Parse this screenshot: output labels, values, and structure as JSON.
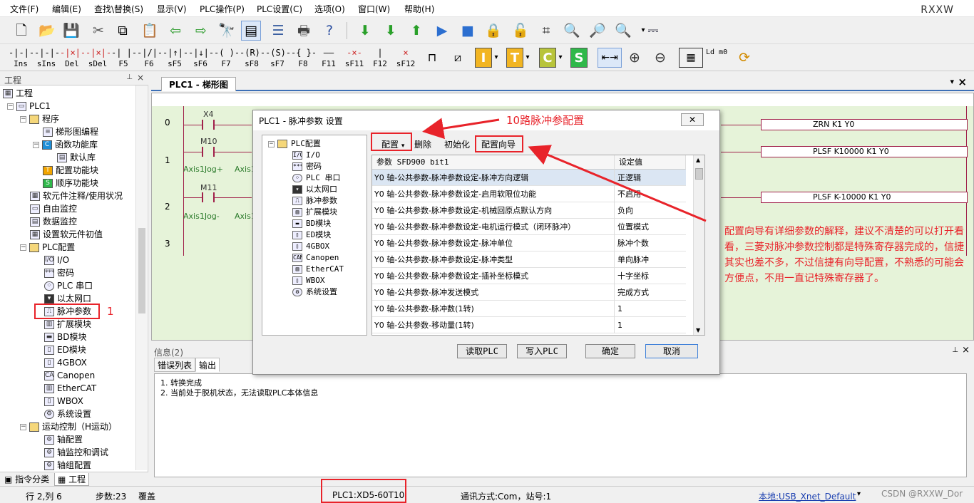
{
  "menu": [
    "文件(F)",
    "编辑(E)",
    "查找\\替换(S)",
    "显示(V)",
    "PLC操作(P)",
    "PLC设置(C)",
    "选项(O)",
    "窗口(W)",
    "帮助(H)"
  ],
  "brand": "RXXW",
  "toolbar2": [
    {
      "label": "Ins",
      "sym": "-|-|-"
    },
    {
      "label": "sIns",
      "sym": "-|-|-"
    },
    {
      "label": "Del",
      "sym": "-|×|-"
    },
    {
      "label": "sDel",
      "sym": "-|×|-"
    },
    {
      "label": "F5",
      "sym": "-| |-"
    },
    {
      "label": "F6",
      "sym": "-|/|-"
    },
    {
      "label": "sF5",
      "sym": "-|↑|-"
    },
    {
      "label": "sF6",
      "sym": "-|↓|-"
    },
    {
      "label": "F7",
      "sym": "-( )-"
    },
    {
      "label": "sF8",
      "sym": "-(R)-"
    },
    {
      "label": "sF7",
      "sym": "-(S)-"
    },
    {
      "label": "F8",
      "sym": "-{ }-"
    },
    {
      "label": "F11",
      "sym": "——"
    },
    {
      "label": "sF11",
      "sym": "-×-"
    },
    {
      "label": "F12",
      "sym": "|"
    },
    {
      "label": "sF12",
      "sym": "×"
    }
  ],
  "letter_icons": [
    "I",
    "T",
    "C",
    "S"
  ],
  "ld_label": "Ld m0",
  "left_panel": {
    "title": "工程",
    "tree": [
      {
        "label": "工程",
        "icon": "project-icon"
      },
      {
        "label": "PLC1",
        "icon": "plc-icon"
      },
      {
        "label": "程序",
        "icon": "folder-icon"
      },
      {
        "label": "梯形图编程",
        "icon": "ladder-icon"
      },
      {
        "label": "函数功能库",
        "icon": "function-icon"
      },
      {
        "label": "默认库",
        "icon": "library-icon"
      },
      {
        "label": "配置功能块",
        "icon": "config-block-icon"
      },
      {
        "label": "顺序功能块",
        "icon": "sequence-block-icon"
      },
      {
        "label": "软元件注释/使用状况",
        "icon": "table-icon"
      },
      {
        "label": "自由监控",
        "icon": "monitor-icon"
      },
      {
        "label": "数据监控",
        "icon": "data-monitor-icon"
      },
      {
        "label": "设置软元件初值",
        "icon": "init-value-icon"
      },
      {
        "label": "PLC配置",
        "icon": "folder-icon"
      },
      {
        "label": "I/O",
        "icon": "io-icon"
      },
      {
        "label": "密码",
        "icon": "password-icon"
      },
      {
        "label": "PLC 串口",
        "icon": "serial-port-icon"
      },
      {
        "label": "以太网口",
        "icon": "ethernet-icon"
      },
      {
        "label": "脉冲参数",
        "icon": "pulse-icon"
      },
      {
        "label": "扩展模块",
        "icon": "expansion-icon"
      },
      {
        "label": "BD模块",
        "icon": "bd-module-icon"
      },
      {
        "label": "ED模块",
        "icon": "ed-module-icon"
      },
      {
        "label": "4GBOX",
        "icon": "4gbox-icon"
      },
      {
        "label": "Canopen",
        "icon": "canopen-icon"
      },
      {
        "label": "EtherCAT",
        "icon": "ethercat-icon"
      },
      {
        "label": "WBOX",
        "icon": "wbox-icon"
      },
      {
        "label": "系统设置",
        "icon": "gear-icon"
      },
      {
        "label": "运动控制（H运动）",
        "icon": "folder-icon"
      },
      {
        "label": "轴配置",
        "icon": "axis-config-icon"
      },
      {
        "label": "轴监控和调试",
        "icon": "axis-monitor-icon"
      },
      {
        "label": "轴组配置",
        "icon": "axis-group-icon"
      }
    ],
    "tabs": [
      "指令分类",
      "工程"
    ]
  },
  "doc_tab": "PLC1 - 梯形图",
  "ladder": {
    "rungs": [
      "0",
      "1",
      "2",
      "3"
    ],
    "contacts": [
      {
        "name": "X4",
        "comment": ""
      },
      {
        "name": "M10",
        "comment": "Axis1Jog+"
      },
      {
        "name": "M11",
        "comment": "Axis1Jog-"
      }
    ],
    "comment_cut": "Axis1",
    "coils": [
      {
        "text": "ZRN      K1         Y0"
      },
      {
        "text": "PLSF    K10000   K1         Y0"
      },
      {
        "text": "PLSF    K-10000 K1          Y0"
      }
    ]
  },
  "info": {
    "title": "信息(2)",
    "tabs": [
      "错误列表",
      "输出"
    ],
    "lines": [
      "1. 转换完成",
      "2. 当前处于脱机状态，无法读取PLC本体信息"
    ]
  },
  "status": {
    "pos": "行 2,列 6",
    "steps": "步数:23",
    "mode": "覆盖",
    "plc": "PLC1:XD5-60T10",
    "comm": "通讯方式:Com，站号:1",
    "local": "本地:USB_Xnet_Default",
    "watermark": "CSDN @RXXW_Dor"
  },
  "dialog": {
    "title": "PLC1 - 脉冲参数 设置",
    "tree": [
      {
        "label": "PLC配置",
        "icon": "folder-icon"
      },
      {
        "label": "I/O",
        "icon": "io-icon"
      },
      {
        "label": "密码",
        "icon": "password-icon"
      },
      {
        "label": "PLC 串口",
        "icon": "serial-port-icon"
      },
      {
        "label": "以太网口",
        "icon": "ethernet-icon"
      },
      {
        "label": "脉冲参数",
        "icon": "pulse-icon"
      },
      {
        "label": "扩展模块",
        "icon": "expansion-icon"
      },
      {
        "label": "BD模块",
        "icon": "bd-module-icon"
      },
      {
        "label": "ED模块",
        "icon": "ed-module-icon"
      },
      {
        "label": "4GBOX",
        "icon": "4gbox-icon"
      },
      {
        "label": "Canopen",
        "icon": "canopen-icon"
      },
      {
        "label": "EtherCAT",
        "icon": "ethercat-icon"
      },
      {
        "label": "WBOX",
        "icon": "wbox-icon"
      },
      {
        "label": "系统设置",
        "icon": "gear-icon"
      }
    ],
    "tools": {
      "config": "配置",
      "delete": "删除",
      "init": "初始化",
      "wizard": "配置向导"
    },
    "columns": [
      "参数 SFD900 bit1",
      "设定值"
    ],
    "rows": [
      {
        "param": "Y0 轴-公共参数-脉冲参数设定-脉冲方向逻辑",
        "value": "正逻辑"
      },
      {
        "param": "Y0 轴-公共参数-脉冲参数设定-启用软限位功能",
        "value": "不启用"
      },
      {
        "param": "Y0 轴-公共参数-脉冲参数设定-机械回原点默认方向",
        "value": "负向"
      },
      {
        "param": "Y0 轴-公共参数-脉冲参数设定-电机运行模式（闭环脉冲）",
        "value": "位置模式"
      },
      {
        "param": "Y0 轴-公共参数-脉冲参数设定-脉冲单位",
        "value": "脉冲个数"
      },
      {
        "param": "Y0 轴-公共参数-脉冲参数设定-脉冲类型",
        "value": "单向脉冲"
      },
      {
        "param": "Y0 轴-公共参数-脉冲参数设定-插补坐标模式",
        "value": "十字坐标"
      },
      {
        "param": "Y0 轴-公共参数-脉冲发送模式",
        "value": "完成方式"
      },
      {
        "param": "Y0 轴-公共参数-脉冲数(1转)",
        "value": "1"
      },
      {
        "param": "Y0 轴-公共参数-移动量(1转)",
        "value": "1"
      }
    ],
    "buttons": {
      "read": "读取PLC",
      "write": "写入PLC",
      "ok": "确定",
      "cancel": "取消"
    }
  },
  "annotations": {
    "top": "10路脉冲参配置",
    "marker": "1",
    "note": "配置向导有详细参数的解释，建议不清楚的可以打开看看，三菱对脉冲参数控制都是特殊寄存器完成的，信捷其实也差不多，不过信捷有向导配置，不熟悉的可能会方便点，不用一直记特殊寄存器了。"
  }
}
